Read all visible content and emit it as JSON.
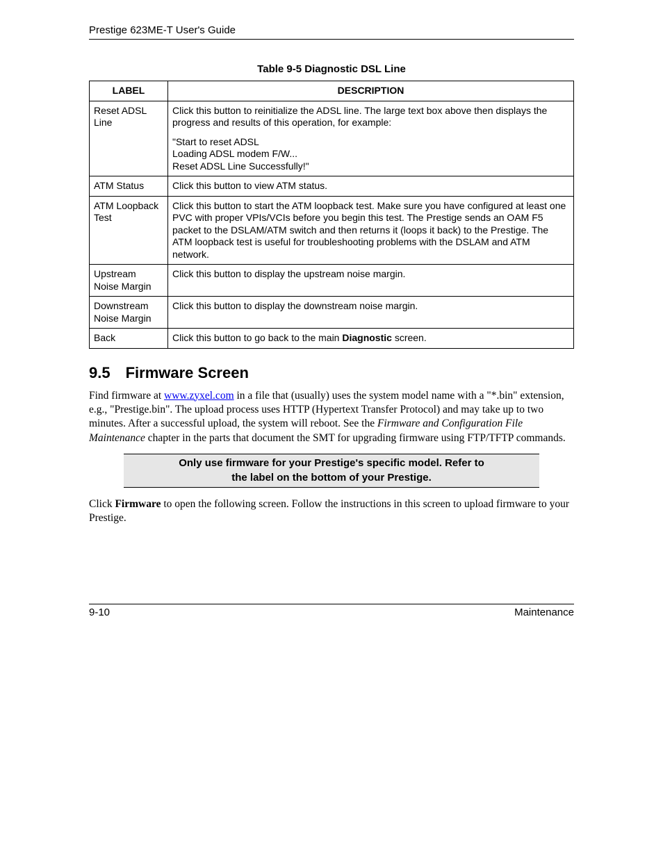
{
  "header": "Prestige 623ME-T User's Guide",
  "tableCaption": "Table 9-5 Diagnostic DSL Line",
  "tableHeaders": {
    "label": "LABEL",
    "description": "DESCRIPTION"
  },
  "rows": [
    {
      "label": "Reset ADSL Line",
      "paras": [
        "Click this button to reinitialize the ADSL line. The large text box above then displays the progress and results of this operation, for example:",
        "\"Start to reset ADSL\nLoading ADSL modem F/W...\nReset ADSL Line Successfully!\""
      ]
    },
    {
      "label": "ATM Status",
      "paras": [
        "Click this button to view ATM status."
      ]
    },
    {
      "label": "ATM Loopback Test",
      "paras": [
        "Click this button to start the ATM loopback test. Make sure you have configured at least one PVC with proper VPIs/VCIs before you begin this test. The Prestige sends an OAM F5 packet to the DSLAM/ATM switch and then returns it (loops it back) to the Prestige. The ATM loopback test is useful for troubleshooting problems with the DSLAM and ATM network."
      ]
    },
    {
      "label": "Upstream Noise Margin",
      "paras": [
        "Click this button to display the upstream noise margin."
      ]
    },
    {
      "label": "Downstream Noise Margin",
      "paras": [
        "Click this button to display the downstream noise margin."
      ]
    },
    {
      "label": "Back",
      "paras": [
        "Click this button to go back to the main |b|Diagnostic|/b| screen."
      ]
    }
  ],
  "section": {
    "number": "9.5",
    "title": "Firmware Screen"
  },
  "para1_parts": {
    "t1": "Find firmware at ",
    "link": "www.zyxel.com",
    "t2": " in a file that (usually) uses the system model name with a \"*.bin\" extension, e.g., \"Prestige.bin\". The upload process uses HTTP (Hypertext Transfer Protocol) and may take up to two minutes. After a successful upload, the system will reboot.  See the ",
    "italic": "Firmware and Configuration File Maintenance",
    "t3": " chapter in the parts that document the SMT for upgrading firmware using FTP/TFTP commands."
  },
  "callout": "Only use firmware for your Prestige's specific model. Refer to the label on the bottom of your Prestige.",
  "para2_parts": {
    "t1": "Click ",
    "bold": "Firmware",
    "t2": " to open the following screen. Follow the instructions in this screen to upload firmware to your Prestige."
  },
  "footer": {
    "left": "9-10",
    "right": "Maintenance"
  }
}
